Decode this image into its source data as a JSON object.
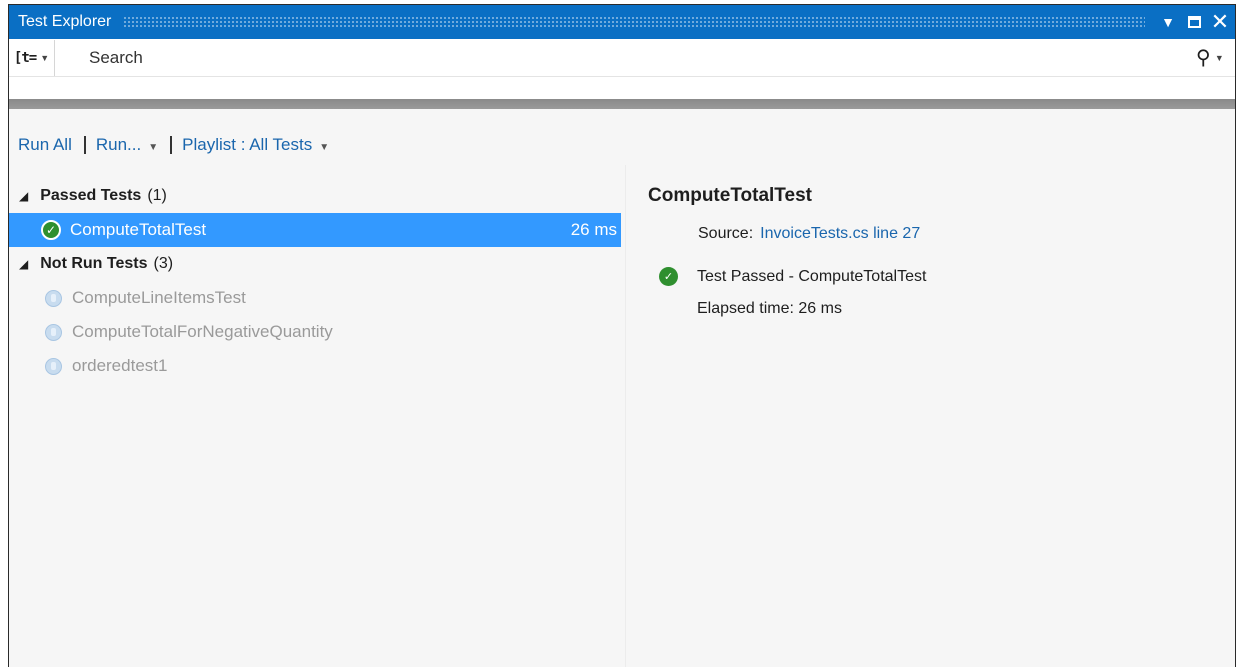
{
  "window": {
    "title": "Test Explorer",
    "icons": {
      "dropdown": "dropdown-triangle-icon",
      "restore": "restore-icon",
      "close": "close-icon"
    }
  },
  "search": {
    "group_icon": "group-by-icon",
    "group_glyph": "[t=",
    "placeholder": "Search",
    "value": "",
    "search_icon": "search-icon"
  },
  "toolbar": {
    "run_all": "Run All",
    "run": "Run...",
    "playlist": "Playlist : All Tests"
  },
  "tree": {
    "passed": {
      "label": "Passed Tests",
      "count": "(1)",
      "items": [
        {
          "name": "ComputeTotalTest",
          "duration": "26 ms",
          "status": "passed",
          "selected": true
        }
      ]
    },
    "not_run": {
      "label": "Not Run Tests",
      "count": "(3)",
      "items": [
        {
          "name": "ComputeLineItemsTest",
          "status": "not-run"
        },
        {
          "name": "ComputeTotalForNegativeQuantity",
          "status": "not-run"
        },
        {
          "name": "orderedtest1",
          "status": "not-run"
        }
      ]
    }
  },
  "detail": {
    "title": "ComputeTotalTest",
    "source_label": "Source:",
    "source_link": "InvoiceTests.cs line 27",
    "result_text": "Test Passed - ComputeTotalTest",
    "elapsed": "Elapsed time: 26 ms"
  },
  "colors": {
    "titlebar": "#0a6fc4",
    "selection": "#3399ff",
    "link": "#1a66ad",
    "passed_icon": "#2f8f2f",
    "not_run_text": "#9a9a9a"
  }
}
